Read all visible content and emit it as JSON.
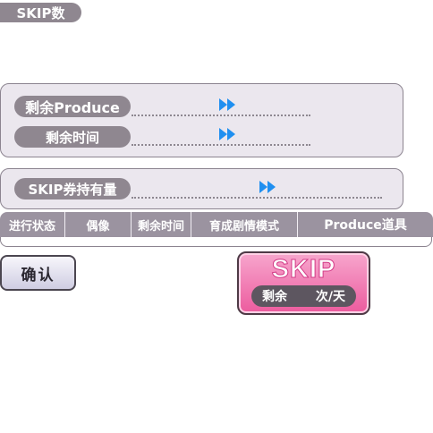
{
  "header": {
    "skip_count_label": "SKIP数"
  },
  "remaining_panel": {
    "produce_label": "剩余Produce",
    "time_label": "剩余时间"
  },
  "ticket_panel": {
    "ticket_label": "SKIP券持有量"
  },
  "table": {
    "columns": [
      "进行状态",
      "偶像",
      "剩余时间",
      "育成剧情模式",
      "Produce道具"
    ]
  },
  "confirm_button": {
    "label": "确认"
  },
  "skip_button": {
    "title": "SKIP",
    "remaining_label": "剩余",
    "per_day_label": "次/天"
  },
  "icons": {
    "fast_forward_color": "#1f8ff0"
  }
}
